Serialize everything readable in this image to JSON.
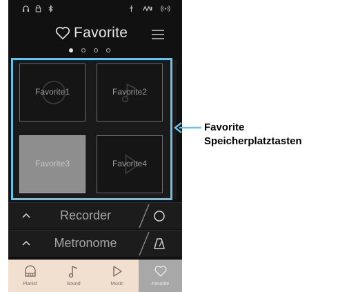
{
  "header": {
    "title": "Favorite"
  },
  "pager": {
    "count": 4,
    "active_index": 0
  },
  "favorites": [
    {
      "label": "Favorite1",
      "selected": false
    },
    {
      "label": "Favorite2",
      "selected": false
    },
    {
      "label": "Favorite3",
      "selected": true
    },
    {
      "label": "Favorite4",
      "selected": false
    }
  ],
  "rows": {
    "recorder": {
      "label": "Recorder",
      "icon": "record-circle-icon"
    },
    "metronome": {
      "label": "Metronome",
      "icon": "metronome-icon"
    }
  },
  "tabs": [
    {
      "label": "Pianist",
      "icon": "piano-icon",
      "active": false
    },
    {
      "label": "Sound",
      "icon": "music-note-icon",
      "active": false
    },
    {
      "label": "Music",
      "icon": "play-icon",
      "active": false
    },
    {
      "label": "Favorite",
      "icon": "heart-icon",
      "active": true
    }
  ],
  "callout": {
    "line1": "Favorite",
    "line2": "Speicherplatztasten"
  },
  "colors": {
    "highlight": "#6ac2e6",
    "tabbar": "#f1dfcf",
    "screen": "#111111"
  }
}
